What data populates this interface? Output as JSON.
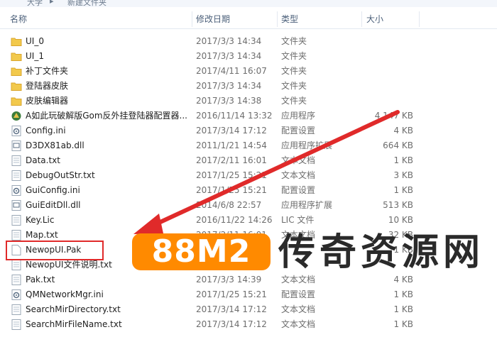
{
  "breadcrumb": [
    "大学",
    "新建文件夹"
  ],
  "columns": {
    "name": "名称",
    "date": "修改日期",
    "type": "类型",
    "size": "大小"
  },
  "files": [
    {
      "name": "UI_0",
      "date": "2017/3/3 14:34",
      "type": "文件夹",
      "size": "",
      "icon": "folder-icon"
    },
    {
      "name": "UI_1",
      "date": "2017/3/3 14:34",
      "type": "文件夹",
      "size": "",
      "icon": "folder-icon"
    },
    {
      "name": "补丁文件夹",
      "date": "2017/4/11 16:07",
      "type": "文件夹",
      "size": "",
      "icon": "folder-icon"
    },
    {
      "name": "登陆器皮肤",
      "date": "2017/3/3 14:34",
      "type": "文件夹",
      "size": "",
      "icon": "folder-icon"
    },
    {
      "name": "皮肤编辑器",
      "date": "2017/3/3 14:38",
      "type": "文件夹",
      "size": "",
      "icon": "folder-icon"
    },
    {
      "name": "A如此玩破解版Gom反外挂登陆器配置器...",
      "date": "2016/11/14 13:32",
      "type": "应用程序",
      "size": "4,147 KB",
      "icon": "app-icon"
    },
    {
      "name": "Config.ini",
      "date": "2017/3/14 17:12",
      "type": "配置设置",
      "size": "4 KB",
      "icon": "config-file-icon"
    },
    {
      "name": "D3DX81ab.dll",
      "date": "2011/1/21 14:54",
      "type": "应用程序扩展",
      "size": "664 KB",
      "icon": "dll-file-icon"
    },
    {
      "name": "Data.txt",
      "date": "2017/2/11 16:01",
      "type": "文本文档",
      "size": "1 KB",
      "icon": "text-file-icon"
    },
    {
      "name": "DebugOutStr.txt",
      "date": "2017/1/25 15:21",
      "type": "文本文档",
      "size": "3 KB",
      "icon": "text-file-icon"
    },
    {
      "name": "GuiConfig.ini",
      "date": "2017/1/25 15:21",
      "type": "配置设置",
      "size": "1 KB",
      "icon": "config-file-icon"
    },
    {
      "name": "GuiEditDll.dll",
      "date": "2014/6/8 22:57",
      "type": "应用程序扩展",
      "size": "513 KB",
      "icon": "dll-file-icon"
    },
    {
      "name": "Key.Lic",
      "date": "2016/11/22 14:26",
      "type": "LIC 文件",
      "size": "10 KB",
      "icon": "text-file-icon"
    },
    {
      "name": "Map.txt",
      "date": "2017/2/11 16:01",
      "type": "文本文档",
      "size": "32 KB",
      "icon": "text-file-icon"
    },
    {
      "name": "NewopUI.Pak",
      "date": "",
      "type": "",
      "size": "1 KB",
      "icon": "blank-file-icon"
    },
    {
      "name": "NewopUI文件说明.txt",
      "date": "",
      "type": "",
      "size": "",
      "icon": "text-file-icon"
    },
    {
      "name": "Pak.txt",
      "date": "2017/3/3 14:39",
      "type": "文本文档",
      "size": "4 KB",
      "icon": "text-file-icon"
    },
    {
      "name": "QMNetworkMgr.ini",
      "date": "2017/1/25 15:21",
      "type": "配置设置",
      "size": "1 KB",
      "icon": "config-file-icon"
    },
    {
      "name": "SearchMirDirectory.txt",
      "date": "2017/3/14 17:12",
      "type": "文本文档",
      "size": "1 KB",
      "icon": "text-file-icon"
    },
    {
      "name": "SearchMirFileName.txt",
      "date": "2017/3/14 17:12",
      "type": "文本文档",
      "size": "1 KB",
      "icon": "text-file-icon"
    }
  ],
  "overlay": {
    "badge": "88M2",
    "brand": "传奇资源网"
  },
  "colors": {
    "folder": "#f2c94c",
    "highlight_box": "#e02a2a",
    "arrow": "#e02a2a",
    "badge_bg": "#ff8a00"
  }
}
